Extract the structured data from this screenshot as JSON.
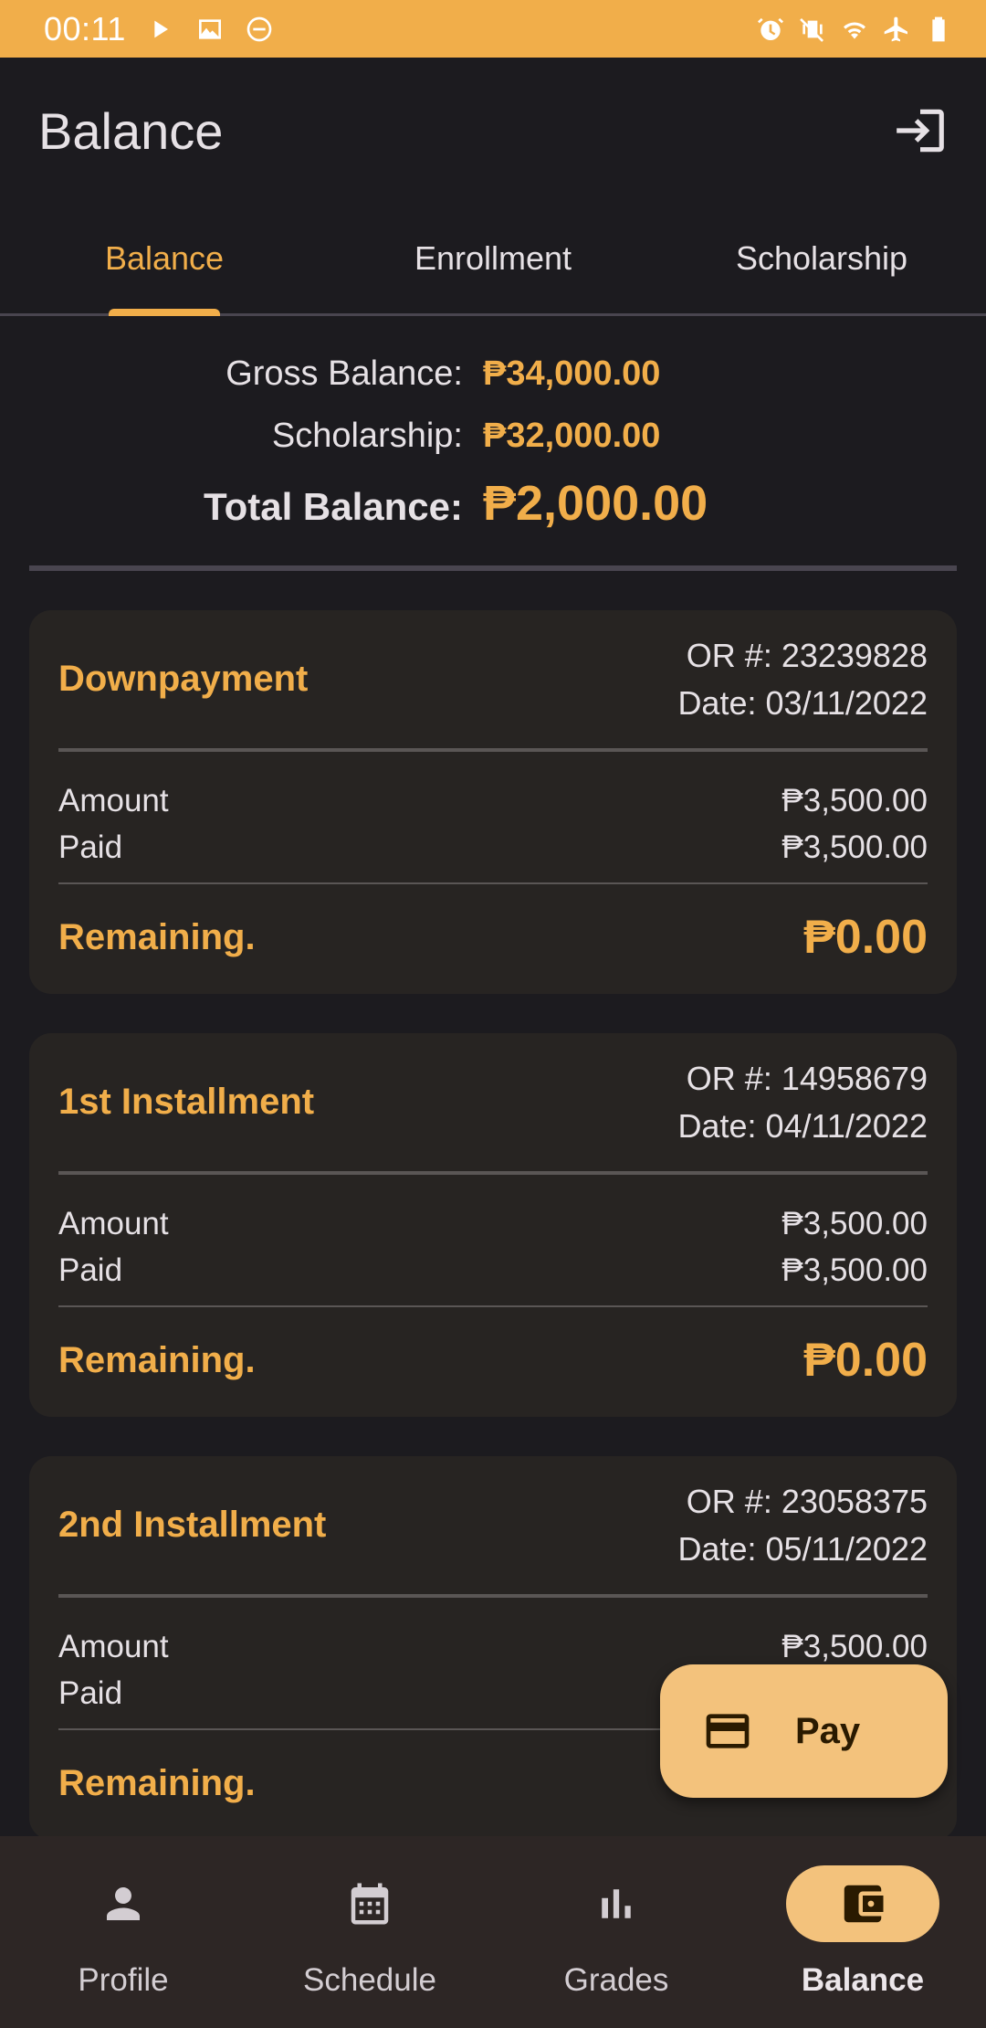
{
  "status_bar": {
    "time": "00:11",
    "left_icons": [
      "play-icon",
      "image-icon",
      "do-not-disturb-icon"
    ],
    "right_icons": [
      "alarm-icon",
      "vibrate-icon",
      "wifi-icon",
      "airplane-icon",
      "battery-icon"
    ],
    "color": "#f1ae4a"
  },
  "app_bar": {
    "title": "Balance",
    "logout_icon": "logout-icon"
  },
  "tabs": [
    {
      "label": "Balance",
      "active": true
    },
    {
      "label": "Enrollment",
      "active": false
    },
    {
      "label": "Scholarship",
      "active": false
    }
  ],
  "summary": {
    "gross_label": "Gross Balance:",
    "gross_value": "₱34,000.00",
    "scholarship_label": "Scholarship:",
    "scholarship_value": "₱32,000.00",
    "total_label": "Total Balance:",
    "total_value": "₱2,000.00"
  },
  "payments": [
    {
      "title": "Downpayment",
      "or_number": "OR #: 23239828",
      "date": "Date: 03/11/2022",
      "amount_label": "Amount",
      "amount": "₱3,500.00",
      "paid_label": "Paid",
      "paid": "₱3,500.00",
      "remaining_label": "Remaining.",
      "remaining": "₱0.00"
    },
    {
      "title": "1st Installment",
      "or_number": "OR #: 14958679",
      "date": "Date: 04/11/2022",
      "amount_label": "Amount",
      "amount": "₱3,500.00",
      "paid_label": "Paid",
      "paid": "₱3,500.00",
      "remaining_label": "Remaining.",
      "remaining": "₱0.00"
    },
    {
      "title": "2nd Installment",
      "or_number": "OR #: 23058375",
      "date": "Date: 05/11/2022",
      "amount_label": "Amount",
      "amount": "₱3,500.00",
      "paid_label": "Paid",
      "paid": "",
      "remaining_label": "Remaining.",
      "remaining": ""
    }
  ],
  "fab": {
    "label": "Pay",
    "icon": "credit-card-icon"
  },
  "bottom_nav": [
    {
      "label": "Profile",
      "icon": "person-icon",
      "active": false
    },
    {
      "label": "Schedule",
      "icon": "calendar-icon",
      "active": false
    },
    {
      "label": "Grades",
      "icon": "bar-chart-icon",
      "active": false
    },
    {
      "label": "Balance",
      "icon": "wallet-icon",
      "active": true
    }
  ],
  "colors": {
    "accent": "#f1ae4a",
    "background": "#1c1b1f",
    "card": "#272422",
    "fab": "#f3c27c",
    "nav_background": "#2d2625"
  }
}
